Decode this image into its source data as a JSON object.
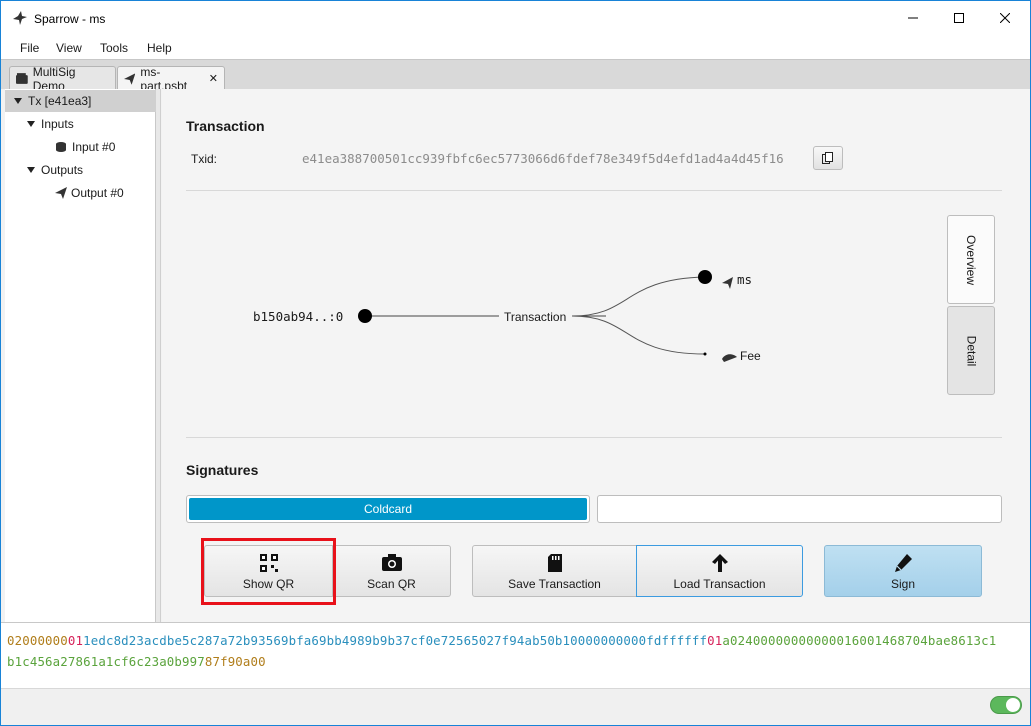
{
  "window": {
    "title": "Sparrow - ms"
  },
  "menu": [
    "File",
    "View",
    "Tools",
    "Help"
  ],
  "tabs": [
    {
      "label": "MultiSig Demo",
      "icon": "wallet-icon"
    },
    {
      "label": "ms-part.psbt",
      "icon": "send-icon",
      "close": "✕"
    }
  ],
  "tree": {
    "root": "Tx [e41ea3]",
    "inputs": "Inputs",
    "input0": "Input #0",
    "outputs": "Outputs",
    "output0": "Output #0"
  },
  "transaction": {
    "heading": "Transaction",
    "txid_label": "Txid:",
    "txid": "e41ea388700501cc939fbfc6ec5773066d6fdef78e349f5d4efd1ad4a4d45f16"
  },
  "diagram": {
    "input": "b150ab94..:0",
    "center": "Transaction",
    "output": "ms",
    "fee": "Fee"
  },
  "side_tabs": {
    "overview": "Overview",
    "detail": "Detail"
  },
  "signatures": {
    "heading": "Signatures",
    "signer": "Coldcard"
  },
  "buttons": {
    "show_qr": "Show QR",
    "scan_qr": "Scan QR",
    "save": "Save Transaction",
    "load": "Load Transaction",
    "sign": "Sign"
  },
  "hex": {
    "line1": [
      {
        "t": "02000000",
        "c": "#b07d1a"
      },
      {
        "t": "01",
        "c": "#d6225a"
      },
      {
        "t": "1edc8d23acdbe5c287a72b93569bfa69bb4989b9b37cf0e72565027f94ab50b10000000000fdffffff",
        "c": "#2a8fbd"
      },
      {
        "t": "01",
        "c": "#d6225a"
      },
      {
        "t": "a024000000000000160014687",
        "c": "#5aa33c"
      },
      {
        "t": "04bae8613c1",
        "c": "#5aa33c"
      }
    ],
    "line2": [
      {
        "t": "b1c456a27861a1cf6c23a0b997",
        "c": "#5aa33c"
      },
      {
        "t": "87f90a00",
        "c": "#b07d1a"
      }
    ]
  },
  "colors": {
    "accent": "#0096c9",
    "highlight": "#e8111a",
    "toggle_on": "#5cb85c"
  }
}
